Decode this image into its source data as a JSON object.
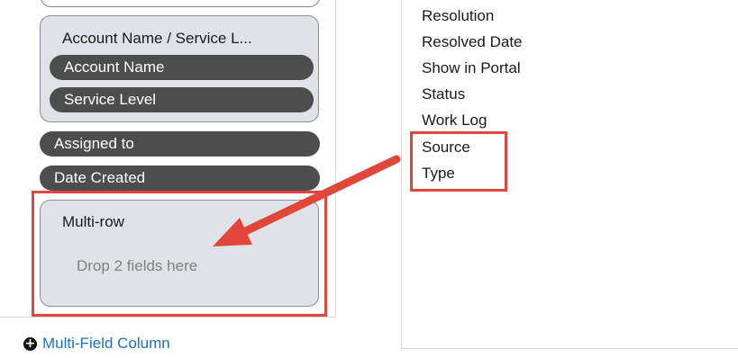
{
  "layout_column": {
    "group": {
      "title": "Account Name / Service L...",
      "fields": [
        "Account Name",
        "Service Level"
      ]
    },
    "fields": [
      "Assigned to",
      "Date Created"
    ],
    "multirow": {
      "title": "Multi-row",
      "hint": "Drop 2 fields here"
    },
    "add_multifield_label": "Multi-Field Column"
  },
  "available_fields": [
    "Resolution",
    "Resolved Date",
    "Show in Portal",
    "Status",
    "Work Log",
    "Source",
    "Type"
  ],
  "annotation": {
    "color": "#e0463a",
    "highlighted_fields": [
      "Source",
      "Type"
    ],
    "target": "Multi-row"
  },
  "colors": {
    "pill_background": "#4d4d4d",
    "group_background": "#dfe3e8",
    "link": "#1d6fc2"
  }
}
